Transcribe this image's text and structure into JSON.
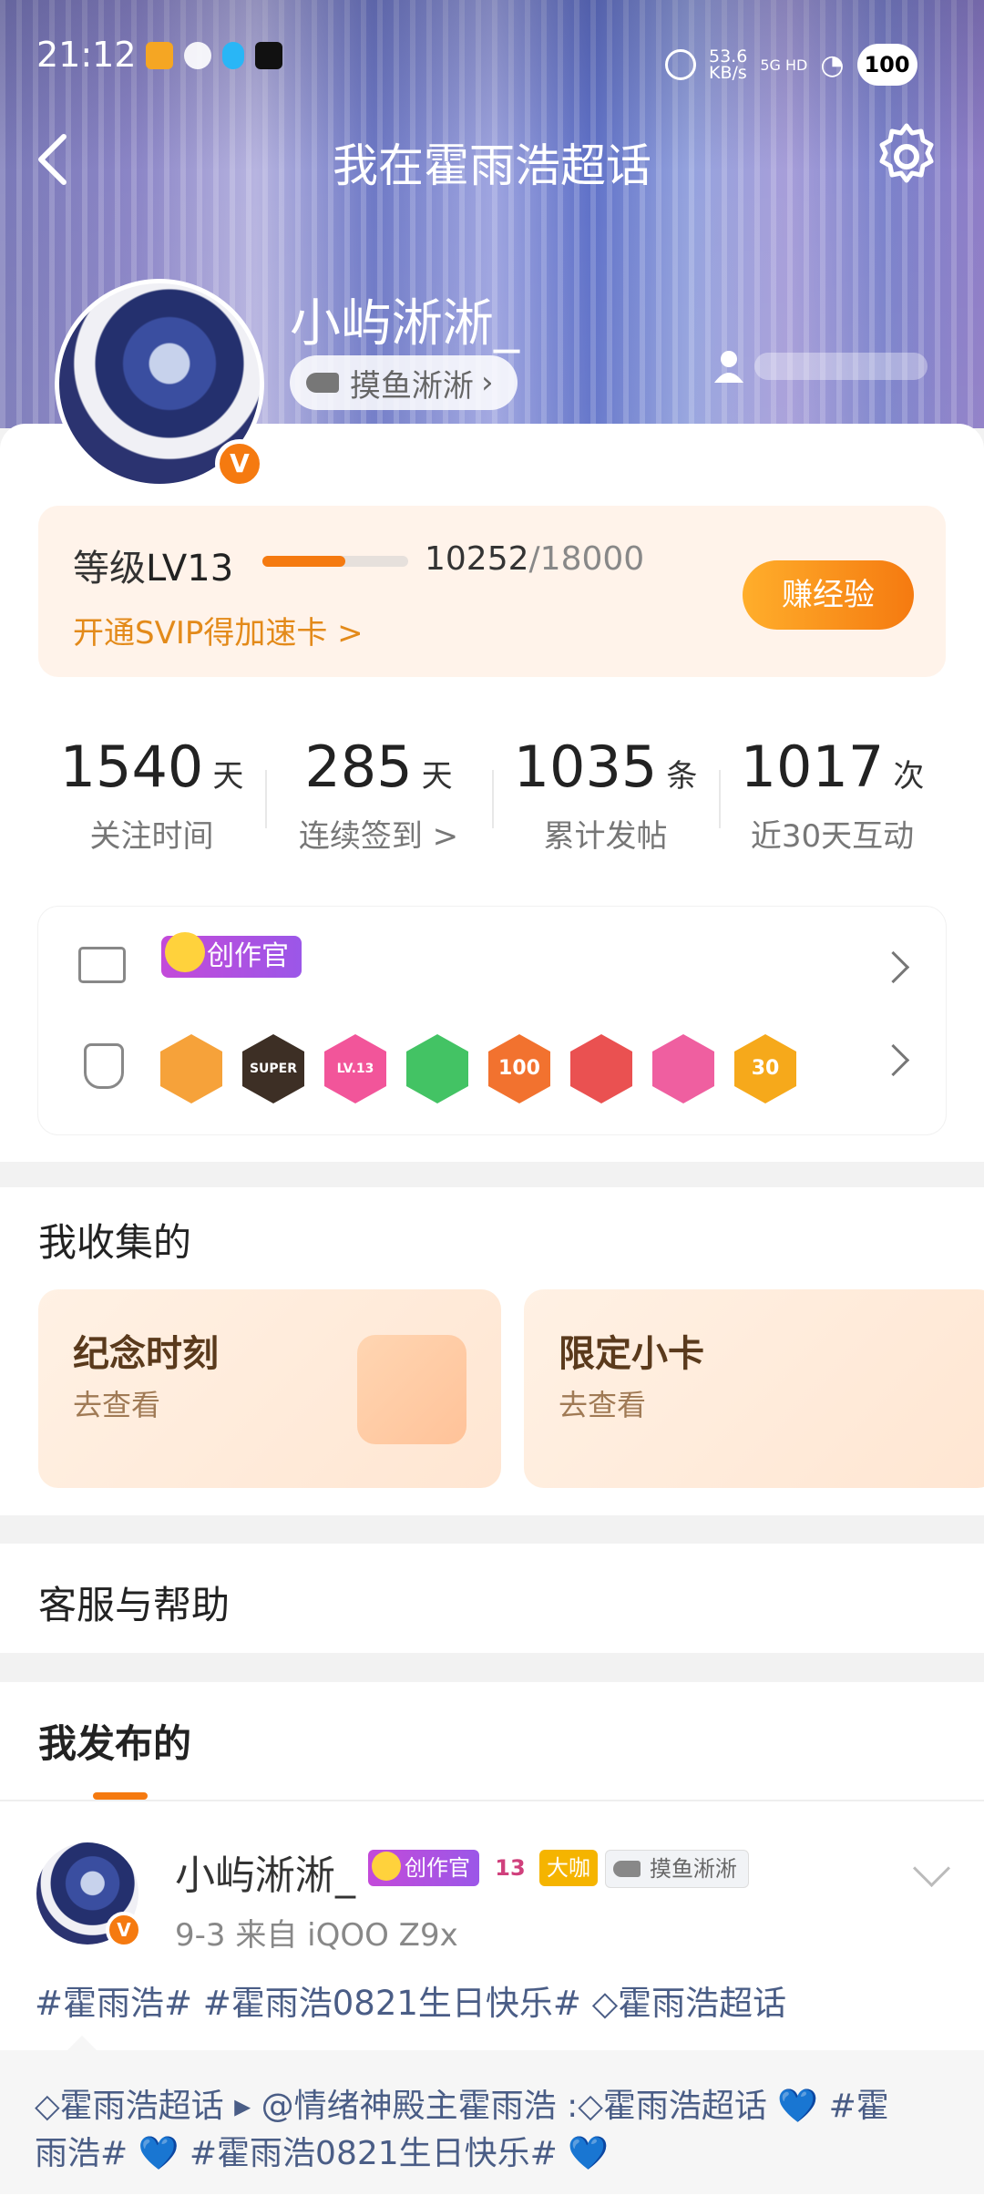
{
  "status_bar": {
    "time": "21:12",
    "net_speed": "53.6",
    "net_unit": "KB/s",
    "signal": "5G HD",
    "battery": "100"
  },
  "header": {
    "title": "我在霍雨浩超话"
  },
  "profile": {
    "username": "小屿淅淅_",
    "tag_label": "摸鱼淅淅",
    "v_badge": "V"
  },
  "level": {
    "label_prefix": "等级",
    "level": "LV13",
    "progress_current": "10252",
    "progress_total": "/18000",
    "progress_fraction": 0.57,
    "svip_text": "开通SVIP得加速卡 >",
    "earn_button": "赚经验"
  },
  "stats": [
    {
      "value": "1540",
      "unit": "天",
      "label": "关注时间"
    },
    {
      "value": "285",
      "unit": "天",
      "label": "连续签到 >"
    },
    {
      "value": "1035",
      "unit": "条",
      "label": "累计发帖"
    },
    {
      "value": "1017",
      "unit": "次",
      "label": "近30天互动"
    }
  ],
  "honors": {
    "creator_badge": "创作官"
  },
  "medals": [
    {
      "name": "crown-medal",
      "color": "#f6a23a",
      "text": ""
    },
    {
      "name": "super-medal",
      "color": "#3d2f25",
      "text": "SUPER"
    },
    {
      "name": "lv-medal",
      "color": "#f2559a",
      "text": "LV.13"
    },
    {
      "name": "hand-medal",
      "color": "#43c364",
      "text": ""
    },
    {
      "name": "100days-medal",
      "color": "#f2722f",
      "text": "100"
    },
    {
      "name": "trophy-medal",
      "color": "#ea5151",
      "text": ""
    },
    {
      "name": "cap-medal",
      "color": "#ef5fa0",
      "text": ""
    },
    {
      "name": "30days-medal",
      "color": "#f6a91b",
      "text": "30"
    }
  ],
  "collections": {
    "title": "我收集的",
    "cards": [
      {
        "title": "纪念时刻",
        "sub": "去查看"
      },
      {
        "title": "限定小卡",
        "sub": "去查看"
      }
    ]
  },
  "help": {
    "title": "客服与帮助"
  },
  "posts_section": {
    "title": "我发布的"
  },
  "post": {
    "author": "小屿淅淅_",
    "badge_creator": "创作官",
    "badge_level": "13",
    "badge_big": "大咖",
    "badge_tag": "摸鱼淅淅",
    "meta": "9-3  来自 iQOO Z9x",
    "text": "#霍雨浩# #霍雨浩0821生日快乐# ◇霍雨浩超话",
    "quote_line1": "◇霍雨浩超话 ▸ @情绪神殿主霍雨浩 :◇霍雨浩超话  💙 #霍",
    "quote_line2": "雨浩# 💙 #霍雨浩0821生日快乐# 💙"
  }
}
